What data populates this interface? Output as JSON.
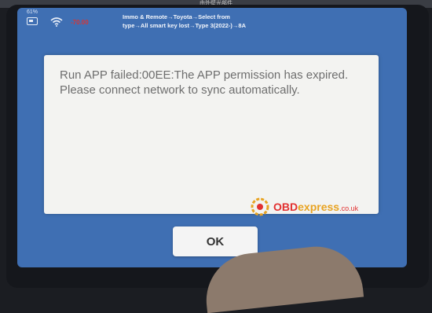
{
  "window": {
    "title_bar": "由外壁光部件"
  },
  "status": {
    "battery_percent": "61%",
    "signal_text": "-70.00",
    "battery_icon": "battery-icon",
    "wifi_icon": "wifi-icon"
  },
  "breadcrumb": {
    "line1": "Immo & Remote→Toyota→Select from",
    "line2": "type→All smart key lost→Type 3(2022-)→8A"
  },
  "dialog": {
    "message": "Run APP failed:00EE:The APP permission has expired.\nPlease connect network to sync automatically.",
    "ok_label": "OK"
  },
  "watermark": {
    "brand_a": "OBD",
    "brand_b": "express",
    "brand_c": ".co.uk"
  },
  "colors": {
    "screen_bg": "#3f6fb3",
    "dialog_bg": "#f3f3f1",
    "signal": "#d63535"
  }
}
